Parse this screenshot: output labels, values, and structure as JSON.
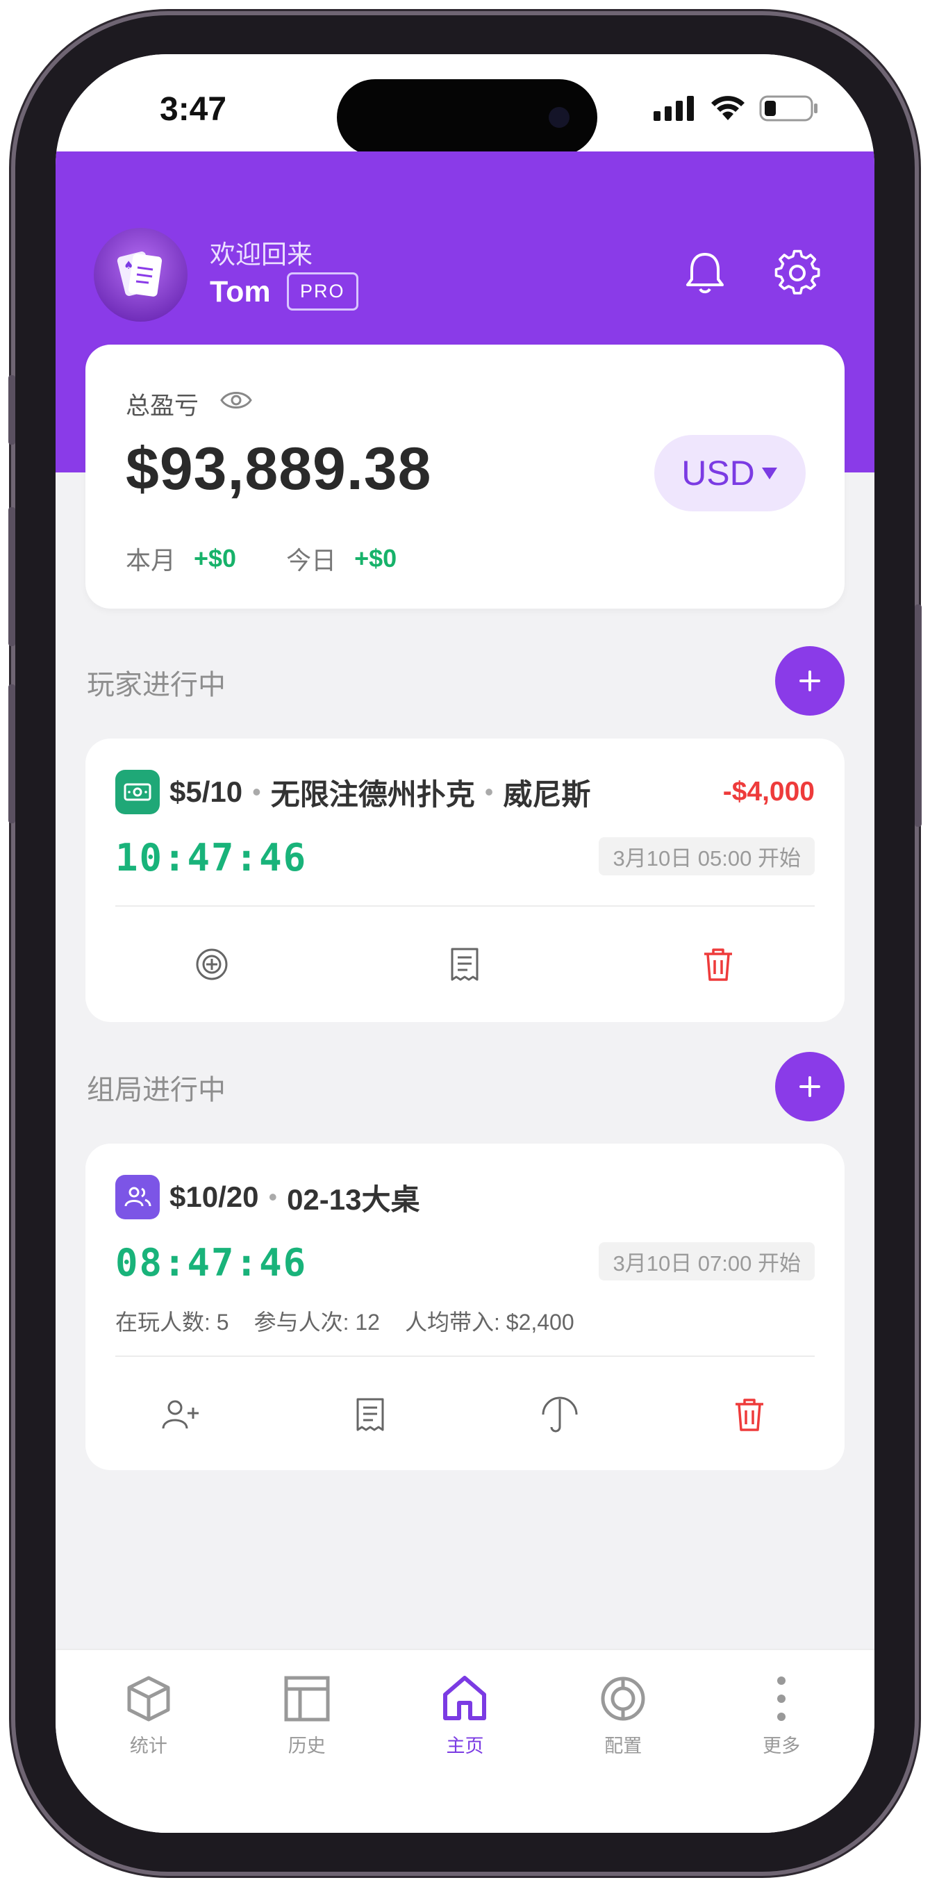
{
  "status_bar": {
    "time": "3:47"
  },
  "header": {
    "welcome": "欢迎回来",
    "username": "Tom",
    "badge": "PRO"
  },
  "summary": {
    "label": "总盈亏",
    "total": "$93,889.38",
    "currency": "USD",
    "month_label": "本月",
    "month_value": "+$0",
    "today_label": "今日",
    "today_value": "+$0"
  },
  "player_section": {
    "title": "玩家进行中",
    "session": {
      "stakes": "$5/10",
      "game": "无限注德州扑克",
      "location": "威尼斯",
      "result": "-$4,000",
      "timer": "10:47:46",
      "start": "3月10日 05:00 开始"
    }
  },
  "host_section": {
    "title": "组局进行中",
    "session": {
      "stakes": "$10/20",
      "table": "02-13大桌",
      "timer": "08:47:46",
      "start": "3月10日 07:00 开始",
      "players_now": "在玩人数: 5",
      "entries": "参与人次: 12",
      "avg_buyin": "人均带入: $2,400"
    }
  },
  "tabs": [
    {
      "label": "统计",
      "icon": "cube-icon",
      "active": false
    },
    {
      "label": "历史",
      "icon": "layout-icon",
      "active": false
    },
    {
      "label": "主页",
      "icon": "home-icon",
      "active": true
    },
    {
      "label": "配置",
      "icon": "chip-icon",
      "active": false
    },
    {
      "label": "更多",
      "icon": "more-icon",
      "active": false
    }
  ],
  "colors": {
    "brand": "#8a3be8",
    "positive": "#17b26a",
    "negative": "#ee3b3b",
    "cash_badge": "#1fa877",
    "host_badge": "#7c55e6"
  }
}
